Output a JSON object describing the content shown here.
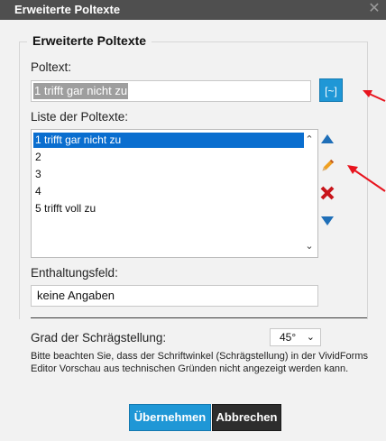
{
  "window": {
    "title": "Erweiterte Poltexte",
    "close_glyph": "✕"
  },
  "group": {
    "title": "Erweiterte Poltexte"
  },
  "poltext": {
    "label": "Poltext:",
    "value": "1 trifft gar nicht zu",
    "button_label": "[~]"
  },
  "list": {
    "label": "Liste der Poltexte:",
    "items": [
      "1 trifft gar nicht zu",
      "2",
      "3",
      "4",
      "5 trifft voll zu"
    ],
    "selected_index": 0
  },
  "enthaltung": {
    "label": "Enthaltungsfeld:",
    "value": "keine Angaben"
  },
  "slant": {
    "label": "Grad der Schrägstellung:",
    "value": "45°"
  },
  "note": "Bitte beachten Sie, dass der Schriftwinkel (Schrägstellung) in der VividForms Editor Vorschau aus technischen Gründen nicht angezeigt werden kann.",
  "buttons": {
    "ok": "Übernehmen",
    "cancel": "Abbrechen"
  },
  "colors": {
    "accent": "#1f97d6",
    "selection": "#0a6ecf",
    "annotation": "#e8141e",
    "pencil": "#f0a020"
  },
  "icons": [
    "move-up-icon",
    "pencil-icon",
    "delete-icon",
    "move-down-icon"
  ]
}
